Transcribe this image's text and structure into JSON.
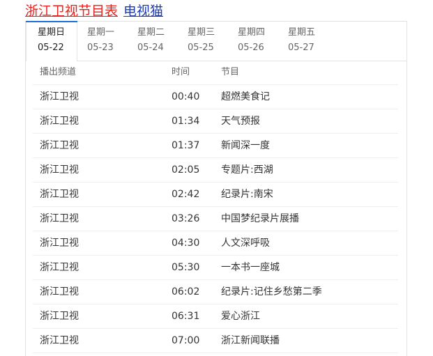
{
  "title": {
    "part1": "浙江卫视节目表",
    "part2": "电视猫"
  },
  "tabs": [
    {
      "day": "星期日",
      "date": "05-22",
      "active": true
    },
    {
      "day": "星期一",
      "date": "05-23",
      "active": false
    },
    {
      "day": "星期二",
      "date": "05-24",
      "active": false
    },
    {
      "day": "星期三",
      "date": "05-25",
      "active": false
    },
    {
      "day": "星期四",
      "date": "05-26",
      "active": false
    },
    {
      "day": "星期五",
      "date": "05-27",
      "active": false
    }
  ],
  "table": {
    "headers": [
      "播出频道",
      "时间",
      "节目"
    ],
    "rows": [
      [
        "浙江卫视",
        "00:40",
        "超燃美食记"
      ],
      [
        "浙江卫视",
        "01:34",
        "天气预报"
      ],
      [
        "浙江卫视",
        "01:37",
        "新闻深一度"
      ],
      [
        "浙江卫视",
        "02:05",
        "专题片:西湖"
      ],
      [
        "浙江卫视",
        "02:42",
        "纪录片:南宋"
      ],
      [
        "浙江卫视",
        "03:26",
        "中国梦纪录片展播"
      ],
      [
        "浙江卫视",
        "04:30",
        "人文深呼吸"
      ],
      [
        "浙江卫视",
        "05:30",
        "一本书一座城"
      ],
      [
        "浙江卫视",
        "06:02",
        "纪录片:记住乡愁第二季"
      ],
      [
        "浙江卫视",
        "06:31",
        "爱心浙江"
      ],
      [
        "浙江卫视",
        "07:00",
        "浙江新闻联播"
      ]
    ]
  },
  "colors": {
    "title_primary": "#e8211c",
    "title_secondary": "#1d3cb0",
    "active_tab_accent": "#1d6fd8"
  }
}
